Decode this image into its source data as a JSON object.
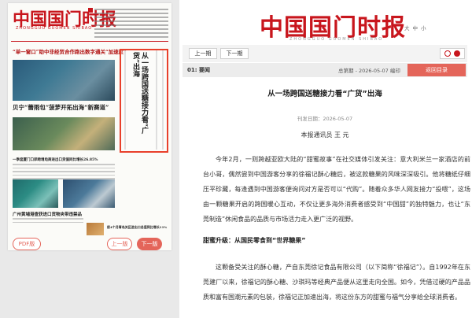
{
  "paper": {
    "masthead": "中国国门时报",
    "headline_1": "“单一窗口”助中非经贸合作跑出数字通关“加速度”",
    "headline_2": "贝宁“蕾雨包”菠萝开拓出海“新赛道”",
    "headline_3": "一季度厦门口岸跨境电商进出口货值同比增长26.85%",
    "headline_4": "广州黄埔港查获进口货物夹带违禁品",
    "headline_5": "前4个月青岛关区进出口总值同比增长11%",
    "lead_story": "从一场跨国送糖接力看“广货”出海",
    "pdf_button": "PDF版",
    "prev_button": "上一版",
    "next_button": "下一版"
  },
  "site": {
    "brand": "中国国门时报",
    "brand_pinyin": "ZHONGGUO  GUOMEN  SHIBAO",
    "font_size_label": "大",
    "font_size_mid": "中",
    "font_size_small": "小"
  },
  "nav": {
    "prev": "上一期",
    "next": "下一期"
  },
  "section_bar": {
    "section": "01: 要闻",
    "pages": "总第期 - 2026-05-07 编印",
    "toc_button": "返回目录"
  },
  "article": {
    "title": "从一场跨国送糖接力看“广货”出海",
    "date": "刊发日期：2026-05-07",
    "author": "本报通讯员  王 元",
    "para1": "今年2月，一则跨越亚欧大陆的“甜蜜故事”在社交媒体引发关注：意大利米兰一家酒店的前台小哥，偶然尝到中国游客分享的徐福记酥心糖后，被这款糖果的风味深深吸引。他将糖纸仔细压平珍藏，每逢遇到中国游客便询问对方是否可以“代购”。随着众多华人网友接力“投喂”，这场由一颗糖果开启的跨国暖心互动，不仅让更多海外消费者感受到“中国甜”的独特魅力，也让“东莞制造”休闲食品的品质与市场活力走入更广泛的视野。",
    "subhead": "甜蜜升级：从国民零食到“世界糖果”",
    "para2": "这颗备受关注的酥心糖，产自东莞徐记食品有限公司（以下简称“徐福记”）。自1992年在东莞建厂以来，徐福记的酥心糖、沙琪玛等经典产品便从这里走向全国。如今，凭借过硬的产品品质和富有国潮元素的包装，徐福记正加速出海，将这份东方的甜蜜与福气分享给全球消费者。"
  }
}
